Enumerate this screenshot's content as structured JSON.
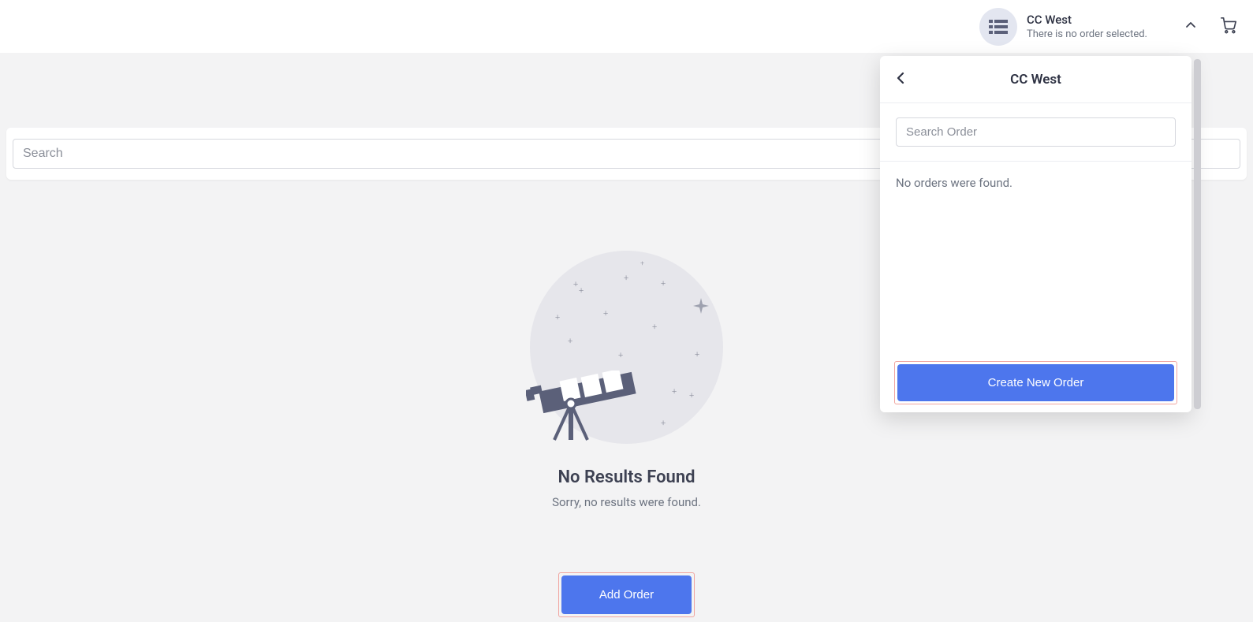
{
  "header": {
    "account_name": "CC West",
    "account_subtitle": "There is no order selected."
  },
  "main": {
    "search_placeholder": "Search",
    "empty_title": "No Results Found",
    "empty_subtitle": "Sorry, no results were found.",
    "add_order_label": "Add Order"
  },
  "dropdown": {
    "title": "CC West",
    "search_placeholder": "Search Order",
    "no_orders_text": "No orders were found.",
    "create_order_label": "Create New Order"
  }
}
